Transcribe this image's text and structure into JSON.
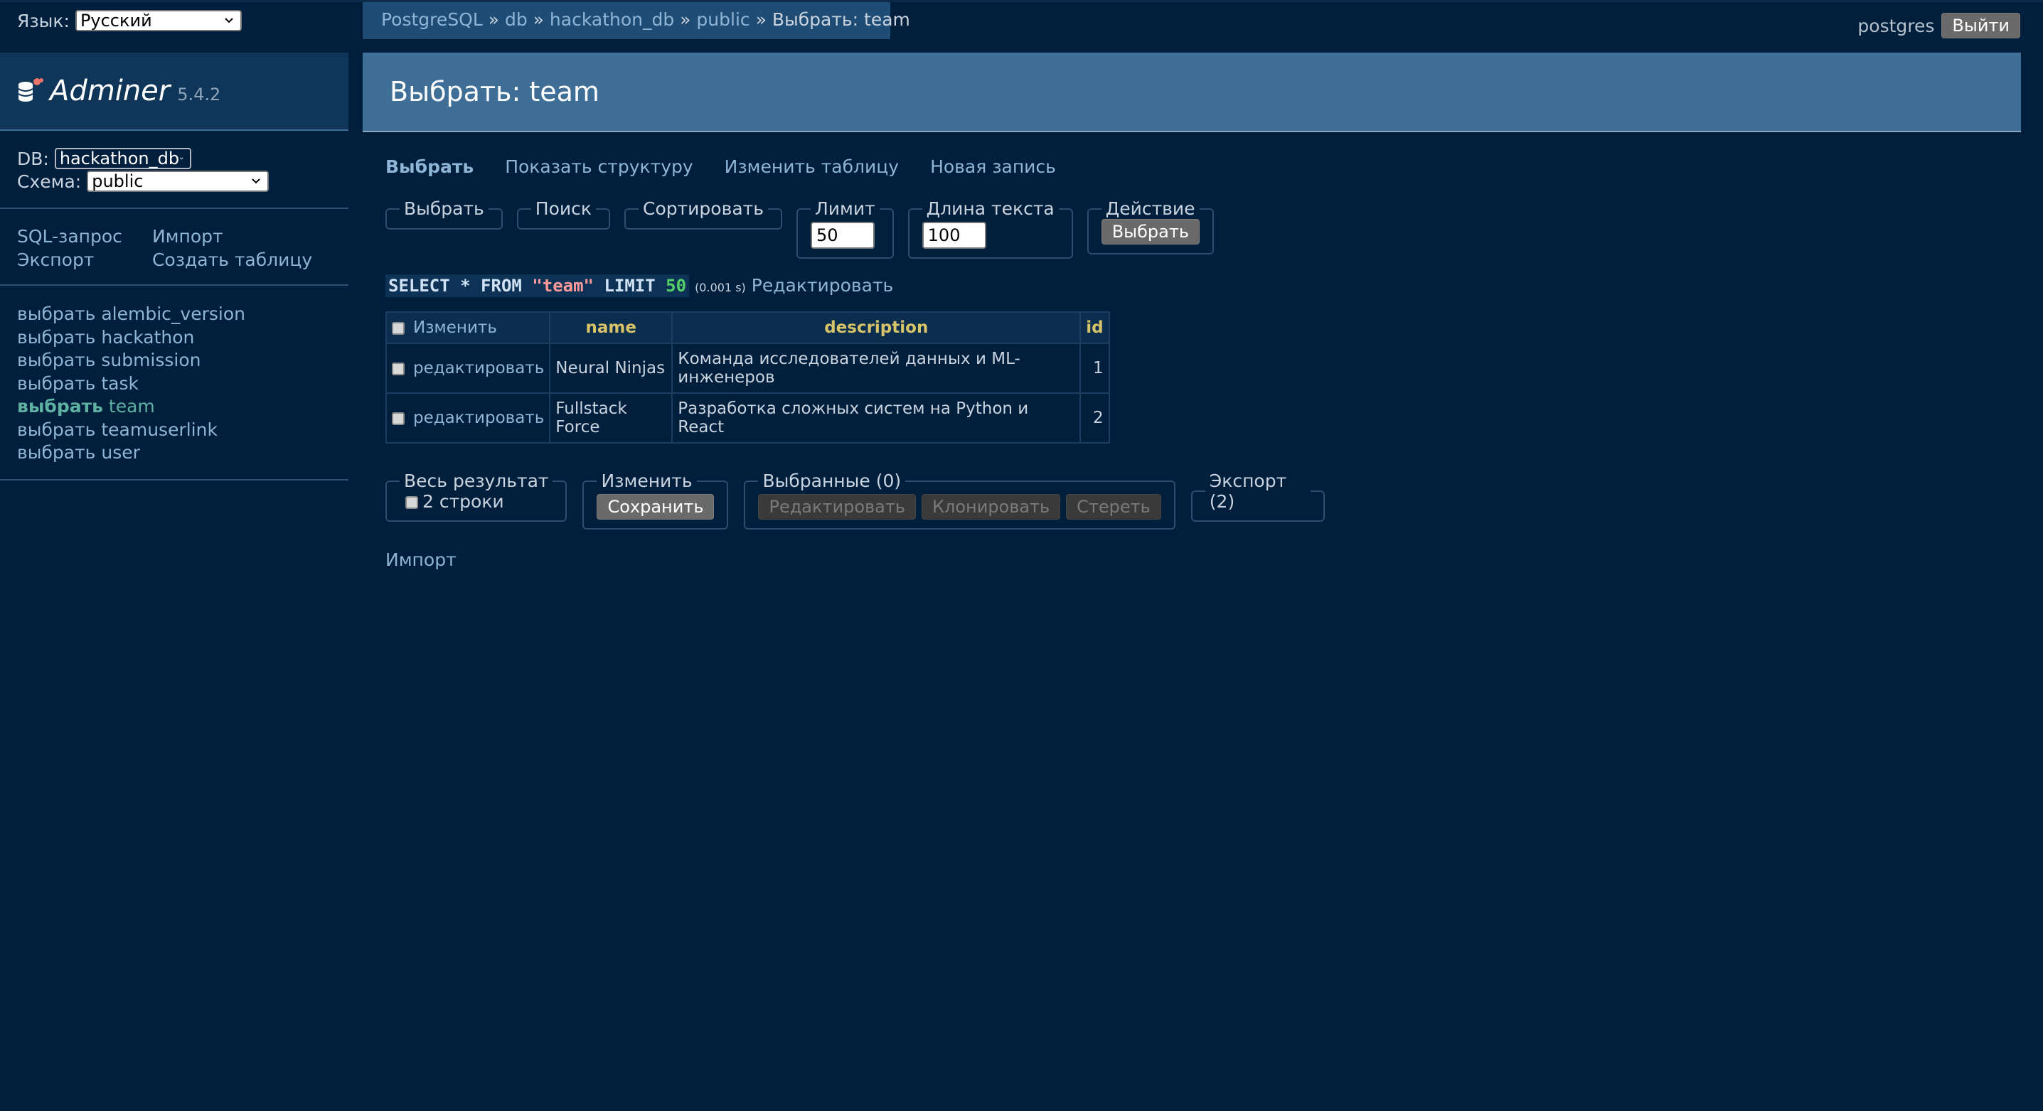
{
  "language": {
    "label": "Язык:",
    "value": "Русский"
  },
  "breadcrumb": {
    "items": [
      "PostgreSQL",
      "db",
      "hackathon_db",
      "public"
    ],
    "current": "Выбрать: team",
    "sep": "»"
  },
  "auth": {
    "user": "postgres",
    "logout": "Выйти"
  },
  "logo": {
    "name": "Adminer",
    "version": "5.4.2"
  },
  "db": {
    "label": "DB:",
    "value": "hackathon_db"
  },
  "schema": {
    "label": "Схема:",
    "value": "public"
  },
  "side_links": {
    "sql": "SQL-запрос",
    "import": "Импорт",
    "export": "Экспорт",
    "create_table": "Создать таблицу"
  },
  "tables": [
    {
      "verb": "выбрать",
      "name": "alembic_version"
    },
    {
      "verb": "выбрать",
      "name": "hackathon"
    },
    {
      "verb": "выбрать",
      "name": "submission"
    },
    {
      "verb": "выбрать",
      "name": "task"
    },
    {
      "verb": "выбрать",
      "name": "team"
    },
    {
      "verb": "выбрать",
      "name": "teamuserlink"
    },
    {
      "verb": "выбрать",
      "name": "user"
    }
  ],
  "title": "Выбрать: team",
  "tabs": {
    "select": "Выбрать",
    "structure": "Показать структуру",
    "alter": "Изменить таблицу",
    "new_item": "Новая запись"
  },
  "filters": {
    "select": "Выбрать",
    "search": "Поиск",
    "sort": "Сортировать",
    "limit_label": "Лимит",
    "limit_value": "50",
    "text_length_label": "Длина текста",
    "text_length_value": "100",
    "action_label": "Действие",
    "action_button": "Выбрать"
  },
  "query": {
    "part1": "SELECT * FROM ",
    "table": "\"team\"",
    "part2": " LIMIT ",
    "limit": "50",
    "time": "(0.001 s)",
    "edit": "Редактировать"
  },
  "table": {
    "headers": {
      "modify": "Изменить",
      "name": "name",
      "description": "description",
      "id": "id"
    },
    "rows": [
      {
        "edit": "редактировать",
        "name": "Neural Ninjas",
        "description": "Команда исследователей данных и ML-инженеров",
        "id": "1"
      },
      {
        "edit": "редактировать",
        "name": "Fullstack Force",
        "description": "Разработка сложных систем на Python и React",
        "id": "2"
      }
    ]
  },
  "bulk": {
    "whole_result": "Весь результат",
    "rows_count": "2 строки",
    "modify": "Изменить",
    "save": "Сохранить",
    "selected": "Выбранные (0)",
    "edit": "Редактировать",
    "clone": "Клонировать",
    "delete": "Стереть",
    "export": "Экспорт (2)"
  },
  "import_link": "Импорт"
}
